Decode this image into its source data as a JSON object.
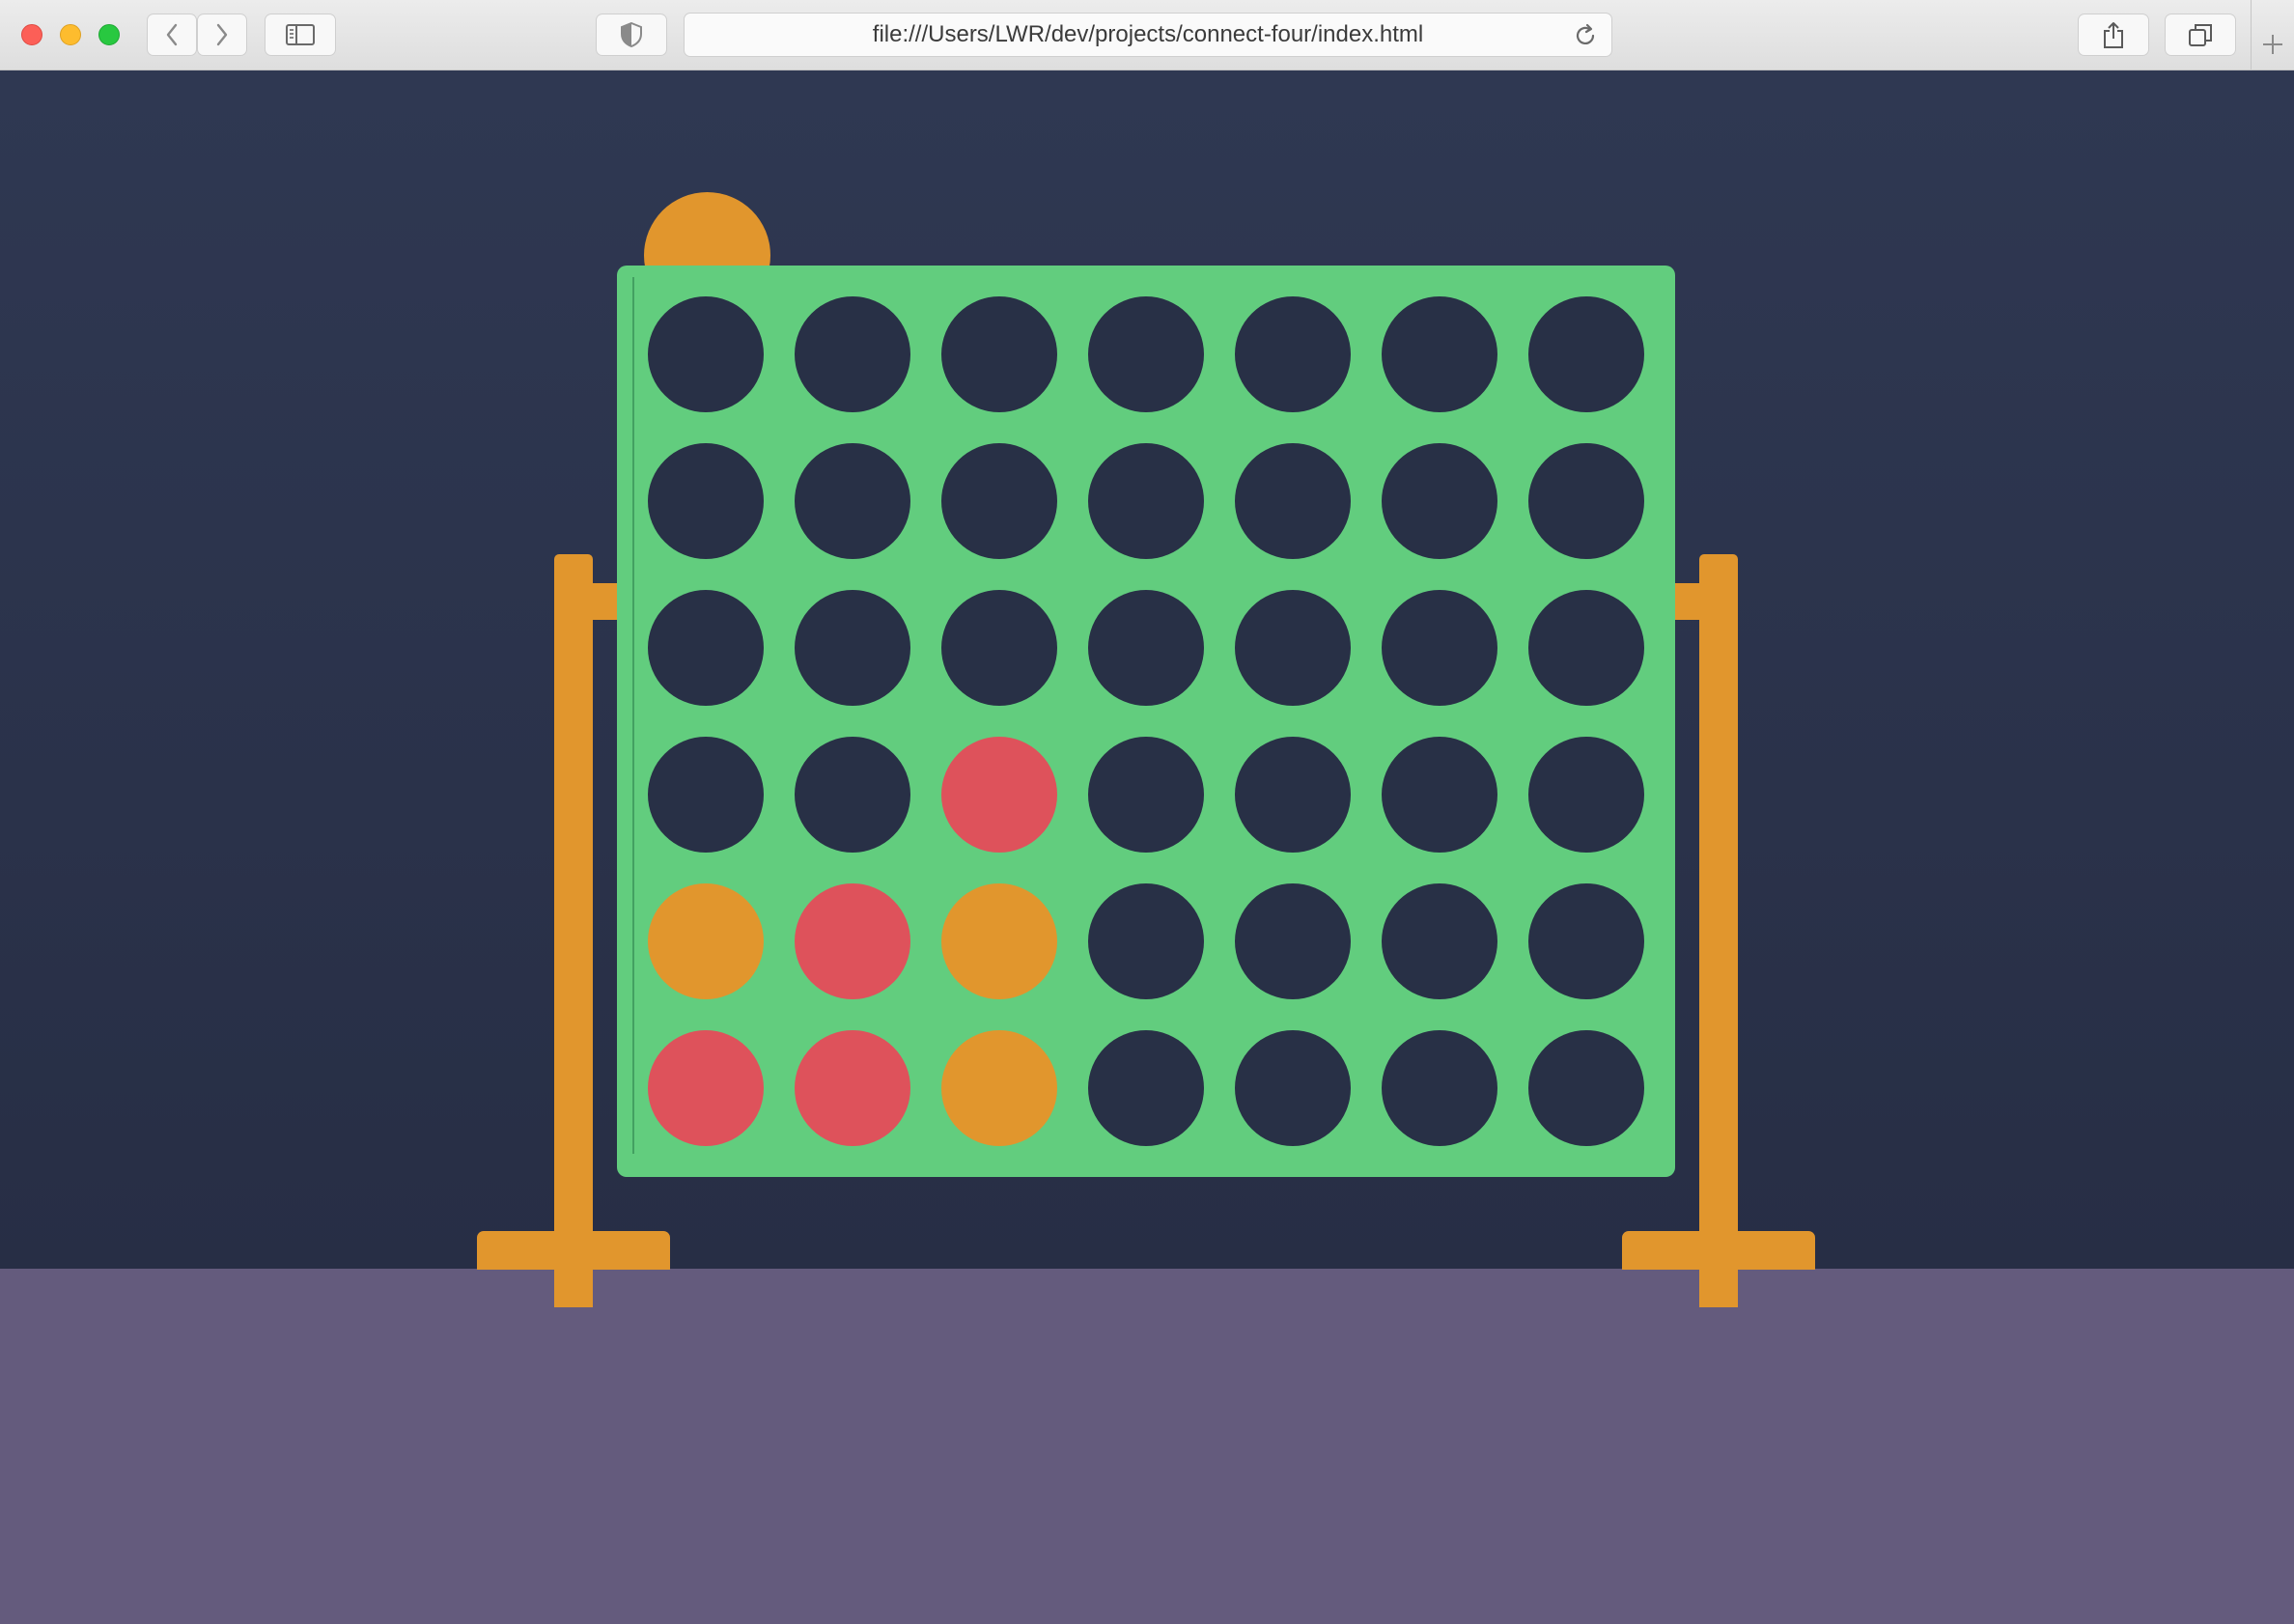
{
  "browser": {
    "url": "file:///Users/LWR/dev/projects/connect-four/index.html",
    "icons": [
      "close-icon",
      "minimize-icon",
      "maximize-icon",
      "back-icon",
      "forward-icon",
      "sidebar-icon",
      "shield-icon",
      "reload-icon",
      "share-icon",
      "tabs-icon",
      "new-tab-icon"
    ]
  },
  "colors": {
    "background": "#2c3550",
    "board": "#62cd7e",
    "empty": "#283046",
    "red": "#de525b",
    "yellow": "#e1962d",
    "floor": "#645b7d"
  },
  "game": {
    "rows": 6,
    "columns": 7,
    "hover_column": 1,
    "hover_piece": "yellow",
    "board": [
      [
        "empty",
        "empty",
        "empty",
        "empty",
        "empty",
        "empty",
        "empty"
      ],
      [
        "empty",
        "empty",
        "empty",
        "empty",
        "empty",
        "empty",
        "empty"
      ],
      [
        "empty",
        "empty",
        "empty",
        "empty",
        "empty",
        "empty",
        "empty"
      ],
      [
        "empty",
        "empty",
        "red",
        "empty",
        "empty",
        "empty",
        "empty"
      ],
      [
        "yellow",
        "red",
        "yellow",
        "empty",
        "empty",
        "empty",
        "empty"
      ],
      [
        "red",
        "red",
        "yellow",
        "empty",
        "empty",
        "empty",
        "empty"
      ]
    ]
  }
}
